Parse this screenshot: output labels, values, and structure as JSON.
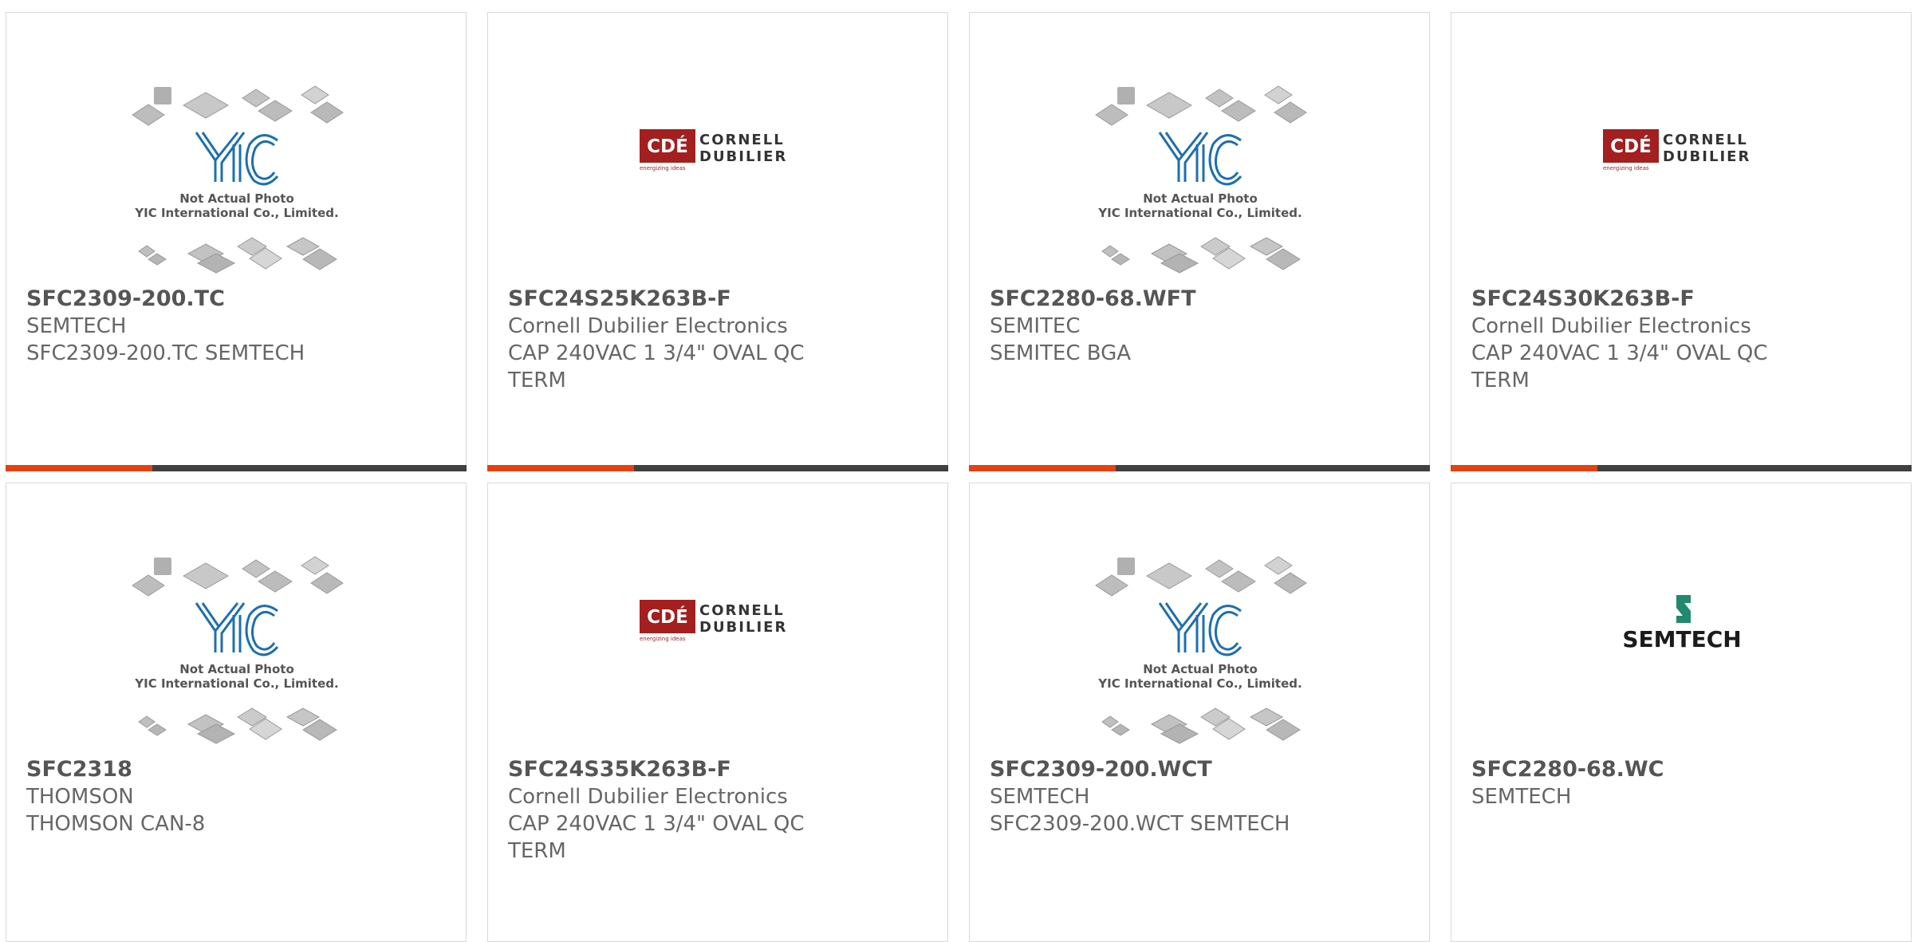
{
  "placeholder": {
    "line1": "Not Actual Photo",
    "line2": "YIC International Co., Limited.",
    "yic_text": "YIC"
  },
  "cde_logo": {
    "badge": "CDÉ",
    "line1": "CORNELL",
    "line2": "DUBILIER",
    "tagline": "energizing ideas"
  },
  "semtech_logo": {
    "word": "SEMTECH"
  },
  "colors": {
    "accent": "#e64011",
    "bar": "#404040",
    "cde_red": "#a31f20"
  },
  "products": [
    {
      "part_number": "SFC2309-200.TC",
      "manufacturer": "SEMTECH",
      "description": "SFC2309-200.TC SEMTECH",
      "image": "yic-placeholder"
    },
    {
      "part_number": "SFC24S25K263B-F",
      "manufacturer": "Cornell Dubilier Electronics",
      "description": "CAP 240VAC 1 3/4\" OVAL QC TERM",
      "image": "cde-logo"
    },
    {
      "part_number": "SFC2280-68.WFT",
      "manufacturer": "SEMITEC",
      "description": "SEMITEC BGA",
      "image": "yic-placeholder"
    },
    {
      "part_number": "SFC24S30K263B-F",
      "manufacturer": "Cornell Dubilier Electronics",
      "description": "CAP 240VAC 1 3/4\" OVAL QC TERM",
      "image": "cde-logo"
    },
    {
      "part_number": "SFC2318",
      "manufacturer": "THOMSON",
      "description": "THOMSON CAN-8",
      "image": "yic-placeholder"
    },
    {
      "part_number": "SFC24S35K263B-F",
      "manufacturer": "Cornell Dubilier Electronics",
      "description": "CAP 240VAC 1 3/4\" OVAL QC TERM",
      "image": "cde-logo"
    },
    {
      "part_number": "SFC2309-200.WCT",
      "manufacturer": "SEMTECH",
      "description": "SFC2309-200.WCT SEMTECH",
      "image": "yic-placeholder"
    },
    {
      "part_number": "SFC2280-68.WC",
      "manufacturer": "SEMTECH",
      "description": "",
      "image": "semtech-logo"
    }
  ]
}
